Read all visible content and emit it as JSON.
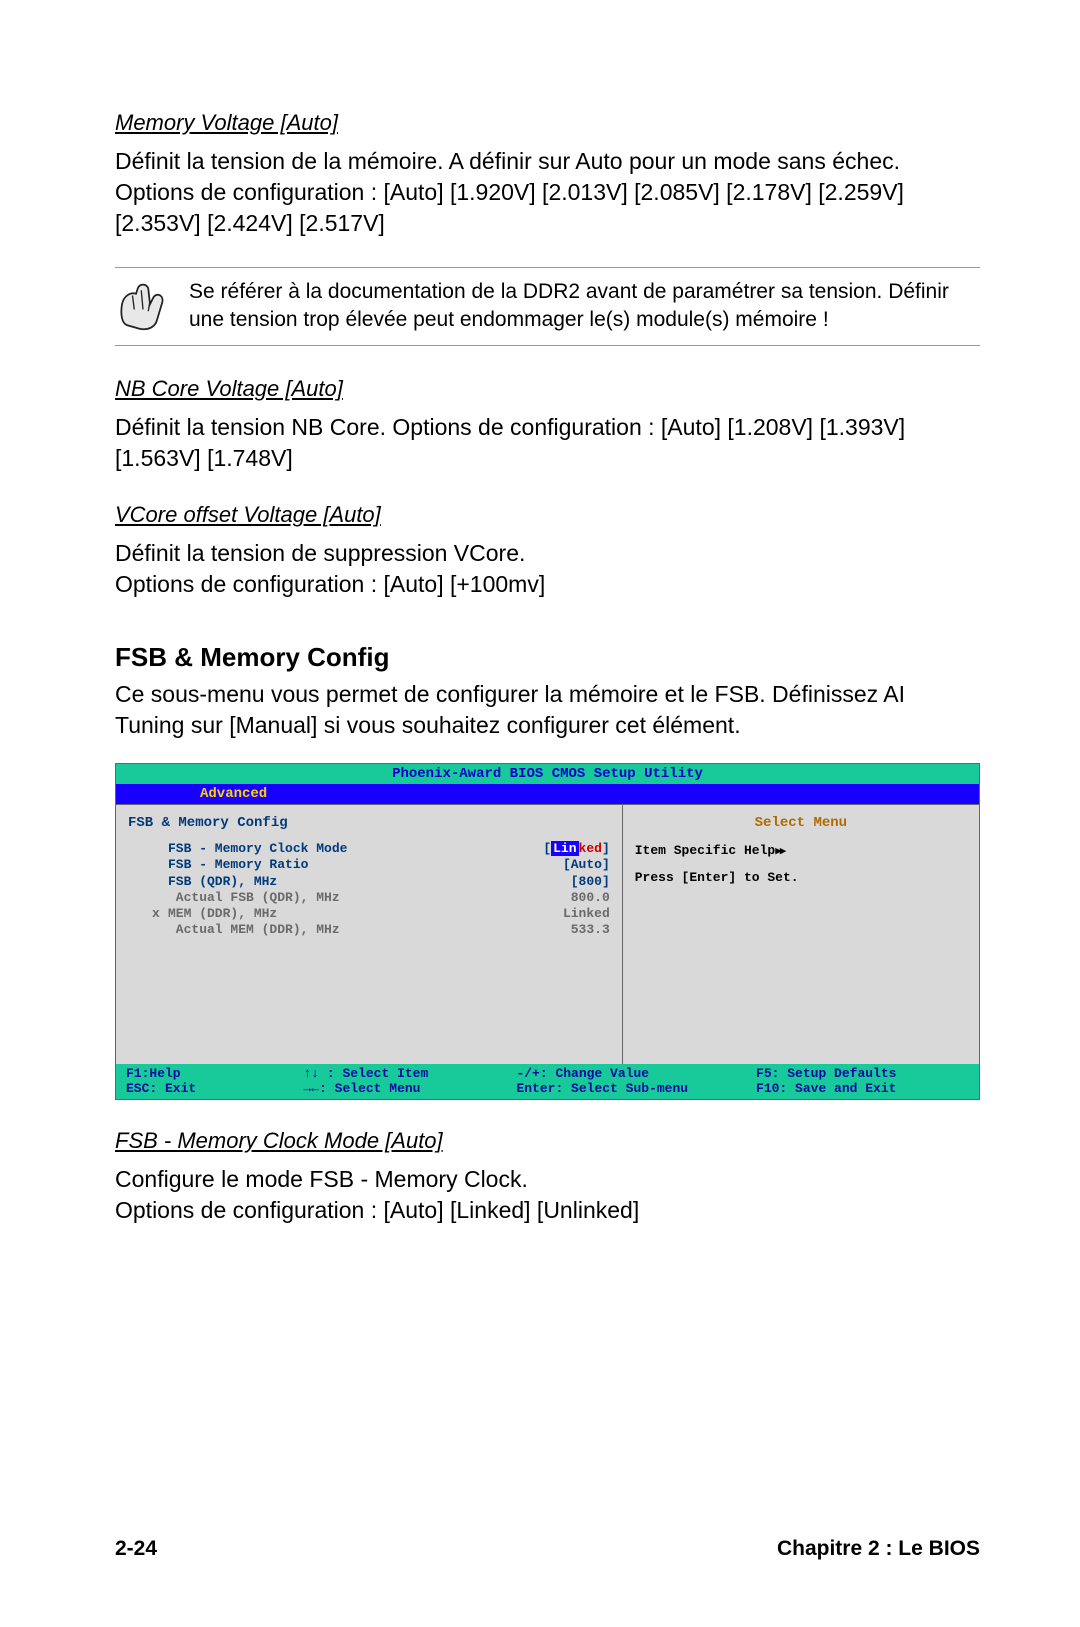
{
  "sections": {
    "memVoltage": {
      "heading": "Memory Voltage [Auto]",
      "body": "Définit la tension de la mémoire. A définir sur Auto pour un mode sans échec. Options de configuration : [Auto] [1.920V] [2.013V] [2.085V] [2.178V]  [2.259V] [2.353V] [2.424V] [2.517V]"
    },
    "note": "Se référer à la documentation de la DDR2 avant de paramétrer sa tension. Définir une tension trop élevée peut endommager le(s) module(s) mémoire !",
    "nbCore": {
      "heading": "NB Core Voltage [Auto]",
      "body": "Définit la tension NB Core. Options de configuration : [Auto] [1.208V] [1.393V] [1.563V] [1.748V]"
    },
    "vcore": {
      "heading": "VCore offset Voltage [Auto]",
      "body": "Définit la tension de suppression VCore.\nOptions de configuration : [Auto] [+100mv]"
    },
    "fsbConfig": {
      "title": "FSB & Memory Config",
      "body": "Ce sous-menu vous permet de configurer la mémoire et le FSB. Définissez AI Tuning sur [Manual] si vous souhaitez configurer cet élément."
    },
    "fsbClock": {
      "heading": "FSB - Memory Clock Mode [Auto]",
      "body": "Configure le mode FSB - Memory Clock.\nOptions de configuration : [Auto] [Linked] [Unlinked]"
    }
  },
  "bios": {
    "title": "Phoenix-Award BIOS CMOS Setup Utility",
    "tab": "Advanced",
    "leftTitle": "FSB & Memory Config",
    "rightTitle": "Select Menu",
    "rightLine1": "Item Specific Help",
    "rightLine2": "Press [Enter] to Set.",
    "rows": [
      {
        "prefix": "",
        "label": "FSB - Memory Clock Mode",
        "valueSel": "Lin",
        "valueTrail": "ked",
        "brOpen": "[",
        "brClose": "]",
        "dim": false
      },
      {
        "prefix": "",
        "label": "FSB - Memory Ratio",
        "value": "[Auto]",
        "dim": false
      },
      {
        "prefix": "",
        "label": "FSB (QDR), MHz",
        "value": "[800]",
        "dim": false
      },
      {
        "prefix": "",
        "label": " Actual FSB (QDR), MHz",
        "value": " 800.0",
        "dim": true
      },
      {
        "prefix": "x",
        "label": "MEM (DDR), MHz",
        "value": "Linked",
        "dim": true
      },
      {
        "prefix": "",
        "label": " Actual MEM (DDR), MHz",
        "value": "533.3",
        "dim": true
      }
    ],
    "footer": {
      "f1": "F1:Help",
      "updown": "↑↓ : Select Item",
      "change": "-/+: Change Value",
      "f5": "F5: Setup Defaults",
      "esc": "ESC: Exit",
      "leftright": "→←: Select Menu",
      "enter": "Enter: Select Sub-menu",
      "f10": "F10: Save and Exit"
    }
  },
  "footer": {
    "left": "2-24",
    "right": "Chapitre 2 : Le BIOS"
  }
}
